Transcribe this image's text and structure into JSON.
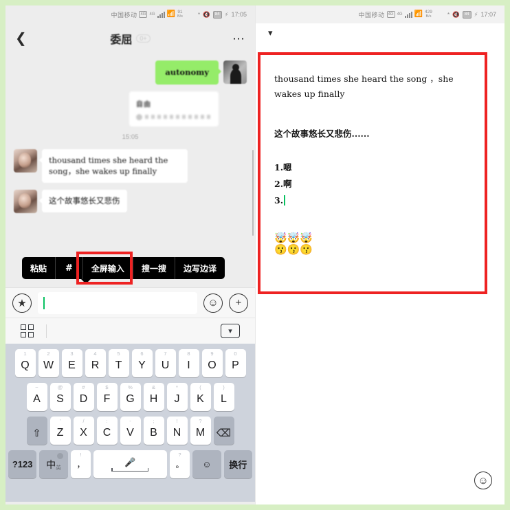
{
  "left": {
    "status": {
      "carrier": "中国移动",
      "volte": "VoLTE",
      "net_type": "4G",
      "speed_value": "91",
      "speed_unit": "B/s",
      "battery": "84",
      "time": "17:05"
    },
    "nav": {
      "back_icon": "chevron-left-icon",
      "title": "委屈",
      "badge": "0+",
      "more_icon": "more-horizontal-icon"
    },
    "chat": {
      "outgoing_text": "autonomy",
      "card_title": "自由",
      "card_subtitle": "一段关于自由的音乐分享",
      "timestamp": "15:05",
      "incoming": [
        "thousand times she heard the song，she wakes up finally",
        "这个故事悠长又悲伤"
      ]
    },
    "toolbar": {
      "items": [
        "粘贴",
        "#",
        "全屏输入",
        "搜一搜",
        "边写边译"
      ],
      "highlighted": "全屏输入",
      "highlight_color": "#ee2222"
    },
    "input": {
      "voice_icon": "voice-input-icon",
      "value": "",
      "placeholder": "",
      "emoji_icon": "emoji-icon",
      "plus_icon": "plus-icon"
    },
    "kb_toolbar": {
      "grid_icon": "grid-menu-icon",
      "collapse_icon": "keyboard-hide-icon"
    },
    "keyboard": {
      "row1": [
        {
          "key": "Q",
          "hint": "1"
        },
        {
          "key": "W",
          "hint": "2"
        },
        {
          "key": "E",
          "hint": "3"
        },
        {
          "key": "R",
          "hint": "4"
        },
        {
          "key": "T",
          "hint": "5"
        },
        {
          "key": "Y",
          "hint": "6"
        },
        {
          "key": "U",
          "hint": "7"
        },
        {
          "key": "I",
          "hint": "8"
        },
        {
          "key": "O",
          "hint": "9"
        },
        {
          "key": "P",
          "hint": "0"
        }
      ],
      "row2": [
        {
          "key": "A",
          "hint": "~"
        },
        {
          "key": "S",
          "hint": "@"
        },
        {
          "key": "D",
          "hint": "#"
        },
        {
          "key": "F",
          "hint": "$"
        },
        {
          "key": "G",
          "hint": "%"
        },
        {
          "key": "H",
          "hint": "&"
        },
        {
          "key": "J",
          "hint": "*"
        },
        {
          "key": "K",
          "hint": "("
        },
        {
          "key": "L",
          "hint": ")"
        }
      ],
      "row3": [
        {
          "key": "Z",
          "hint": "'"
        },
        {
          "key": "X",
          "hint": "/"
        },
        {
          "key": "C",
          "hint": ":"
        },
        {
          "key": "V",
          "hint": "-"
        },
        {
          "key": "B",
          "hint": ";"
        },
        {
          "key": "N",
          "hint": "!"
        },
        {
          "key": "M",
          "hint": "?"
        }
      ],
      "shift_icon": "shift-icon",
      "backspace_icon": "backspace-icon",
      "numeric_key": "?123",
      "lang_key_cn": "中",
      "lang_key_en": "英",
      "punct_top": "!",
      "punct_bottom": "，",
      "space_icon": "microphone-icon",
      "question_top": "?",
      "question_bottom": "。",
      "emoji_key": "emoji-icon",
      "enter_key": "换行"
    }
  },
  "right": {
    "status": {
      "carrier": "中国移动",
      "volte": "VoLTE",
      "net_type": "4G",
      "speed_value": "429",
      "speed_unit": "B/s",
      "battery": "84",
      "time": "17:07"
    },
    "collapse_icon": "chevron-down-icon",
    "editor": {
      "paragraph_en": "thousand times she heard the song ，she wakes up finally",
      "paragraph_zh": "这个故事悠长又悲伤......",
      "list": [
        "1.嗯",
        "2.啊",
        "3."
      ],
      "emoji_row1": "🤯🤯🤯",
      "emoji_row2": "😗😗😗",
      "highlight_color": "#ee2222"
    },
    "emoji_button": "emoji-icon"
  }
}
